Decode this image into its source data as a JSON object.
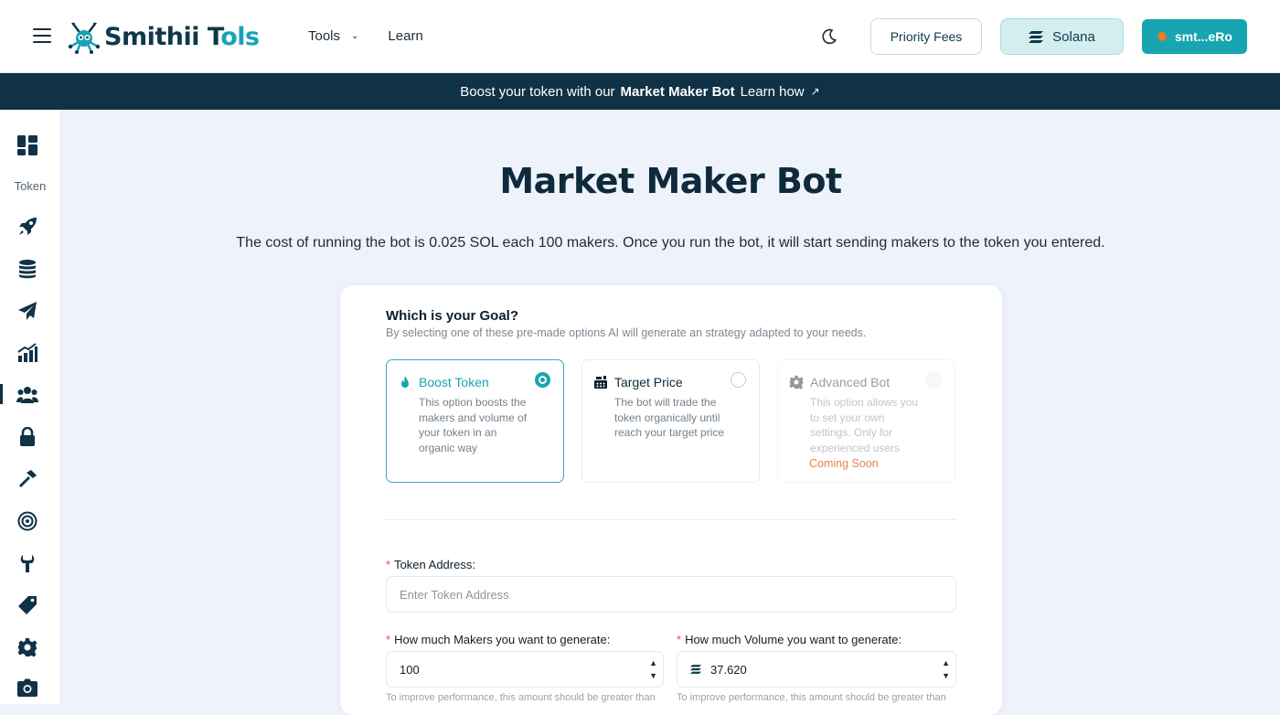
{
  "header": {
    "logo": {
      "text_main": "Smithii T",
      "text_accent": "ols",
      "full": "Smithii Tools"
    },
    "nav": {
      "tools_label": "Tools",
      "learn_label": "Learn"
    },
    "priority_fees_label": "Priority Fees",
    "network_label": "Solana",
    "wallet_label": "smt...eRo"
  },
  "banner": {
    "prefix": "Boost your token with our",
    "bold": "Market Maker Bot",
    "link": "Learn how"
  },
  "sidebar": {
    "section_label": "Token",
    "icons": [
      "dashboard-icon",
      "rocket-icon",
      "database-icon",
      "paper-plane-icon",
      "chart-icon",
      "users-icon",
      "lock-icon",
      "hammer-icon",
      "target-icon",
      "wrench-icon",
      "tag-icon",
      "gear-icon",
      "camera-icon"
    ]
  },
  "page": {
    "title": "Market Maker Bot",
    "description": "The cost of running the bot is 0.025 SOL each 100 makers. Once you run the bot, it will start sending makers to the token you entered."
  },
  "form": {
    "goal_heading": "Which is your Goal?",
    "goal_subheading": "By selecting one of these pre-made options AI will generate an strategy adapted to your needs.",
    "options": [
      {
        "title": "Boost Token",
        "description": "This option boosts the makers and volume of your token in an organic way",
        "selected": true
      },
      {
        "title": "Target Price",
        "description": "The bot will trade the token organically until reach your target price",
        "selected": false
      },
      {
        "title": "Advanced Bot",
        "description": "This option allows you to set your own settings. Only for experienced users",
        "badge": "Coming Soon",
        "disabled": true
      }
    ],
    "token_address": {
      "label": "Token Address:",
      "placeholder": "Enter Token Address",
      "value": ""
    },
    "makers": {
      "label": "How much Makers you want to generate:",
      "value": "100",
      "hint": "To improve performance, this amount should be greater than"
    },
    "volume": {
      "label": "How much Volume you want to generate:",
      "value": "37.620",
      "hint": "To improve performance, this amount should be greater than"
    }
  },
  "colors": {
    "accent": "#18a5b1",
    "navy": "#0f3246",
    "page_bg": "#eef3fb",
    "required": "#e5484d",
    "soon": "#e8834b"
  }
}
